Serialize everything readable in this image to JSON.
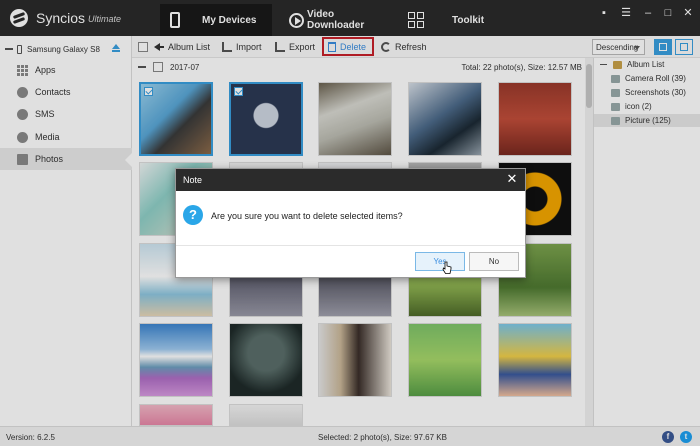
{
  "titlebar": {
    "app_name": "Syncios",
    "app_edition": "Ultimate",
    "tabs": [
      {
        "label": "My Devices",
        "icon": "phone-icon",
        "active": true
      },
      {
        "label": "Video Downloader",
        "icon": "play-icon",
        "active": false
      },
      {
        "label": "Toolkit",
        "icon": "toolkit-grid-icon",
        "active": false
      }
    ],
    "window_controls": [
      "message-icon",
      "menu-icon",
      "minimize-icon",
      "maximize-icon",
      "close-icon"
    ]
  },
  "sidebar": {
    "device_name": "Samsung Galaxy S8",
    "items": [
      {
        "label": "Apps",
        "icon": "apps-grid-icon",
        "active": false
      },
      {
        "label": "Contacts",
        "icon": "contacts-icon",
        "active": false
      },
      {
        "label": "SMS",
        "icon": "sms-icon",
        "active": false
      },
      {
        "label": "Media",
        "icon": "media-icon",
        "active": false
      },
      {
        "label": "Photos",
        "icon": "photos-icon",
        "active": true
      }
    ]
  },
  "toolbar": {
    "album_list": "Album List",
    "import": "Import",
    "export": "Export",
    "delete": "Delete",
    "refresh": "Refresh",
    "sort_value": "Descending"
  },
  "group": {
    "name": "2017-07",
    "total": "Total: 22 photo(s), Size: 12.57 MB"
  },
  "album_panel": {
    "items": [
      {
        "label": "Album List",
        "level": 0,
        "active": false
      },
      {
        "label": "Camera Roll (39)",
        "level": 1,
        "active": false
      },
      {
        "label": "Screenshots (30)",
        "level": 1,
        "active": false
      },
      {
        "label": "icon (2)",
        "level": 1,
        "active": false
      },
      {
        "label": "Picture (125)",
        "level": 1,
        "active": true
      }
    ]
  },
  "status": {
    "version": "Version: 6.2.5",
    "selected": "Selected: 2 photo(s), Size: 97.67 KB"
  },
  "dialog": {
    "title": "Note",
    "message": "Are you sure you want to delete selected items?",
    "yes": "Yes",
    "no": "No"
  },
  "colors": {
    "accent": "#3aa0e0",
    "titlebar": "#2b2b2b",
    "delete_highlight": "#c8202a",
    "facebook": "#3b5998",
    "twitter": "#1da1f2"
  }
}
